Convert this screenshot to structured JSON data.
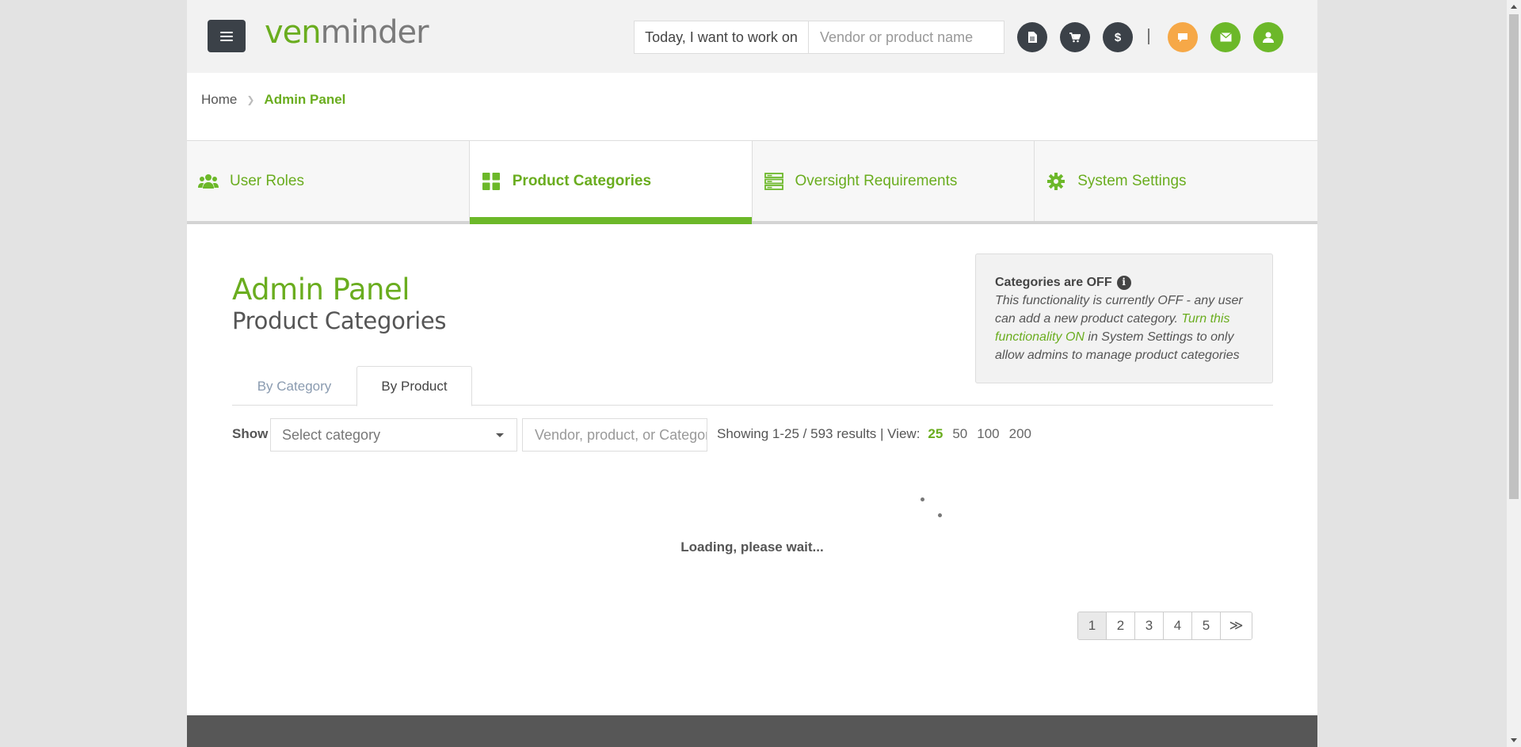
{
  "colors": {
    "brand_green": "#6aad1f",
    "tab_active_bar": "#6cb829",
    "header_bg": "#f2f2f2",
    "dark_icon": "#3b4148",
    "footer": "#575757"
  },
  "header": {
    "logo_ven": "ven",
    "logo_minder": "minder",
    "work_label": "Today, I want to work on",
    "work_placeholder": "Vendor or product name",
    "icons": [
      "document-icon",
      "cart-icon",
      "dollar-icon",
      "chat-icon",
      "mail-icon",
      "user-icon"
    ],
    "dollar_glyph": "$"
  },
  "breadcrumb": {
    "home": "Home",
    "separator": "❯",
    "current": "Admin Panel"
  },
  "tabs": [
    {
      "label": "User Roles",
      "icon": "users-icon"
    },
    {
      "label": "Product Categories",
      "icon": "grid-icon",
      "active": true
    },
    {
      "label": "Oversight Requirements",
      "icon": "server-list-icon"
    },
    {
      "label": "System Settings",
      "icon": "gear-icon"
    }
  ],
  "page": {
    "title": "Admin Panel",
    "subtitle": "Product Categories"
  },
  "info": {
    "title": "Categories are OFF",
    "info_glyph": "i",
    "text_before": "This functionality is currently OFF - any user can add a new product category. ",
    "link": "Turn this functionality ON",
    "text_after": " in System Settings to only allow admins to manage product categories"
  },
  "subtabs": {
    "by_category": "By Category",
    "by_product": "By Product",
    "active": "by_product"
  },
  "filters": {
    "show_label": "Show",
    "category_placeholder": "Select category",
    "search_placeholder": "Vendor, product, or Category",
    "results_text": "Showing 1-25 / 593 results | View:",
    "view_options": [
      "25",
      "50",
      "100",
      "200"
    ],
    "view_selected": "25"
  },
  "loading": {
    "text": "Loading, please wait..."
  },
  "pagination": {
    "pages": [
      "1",
      "2",
      "3",
      "4",
      "5"
    ],
    "next": "≫",
    "active": "1"
  }
}
